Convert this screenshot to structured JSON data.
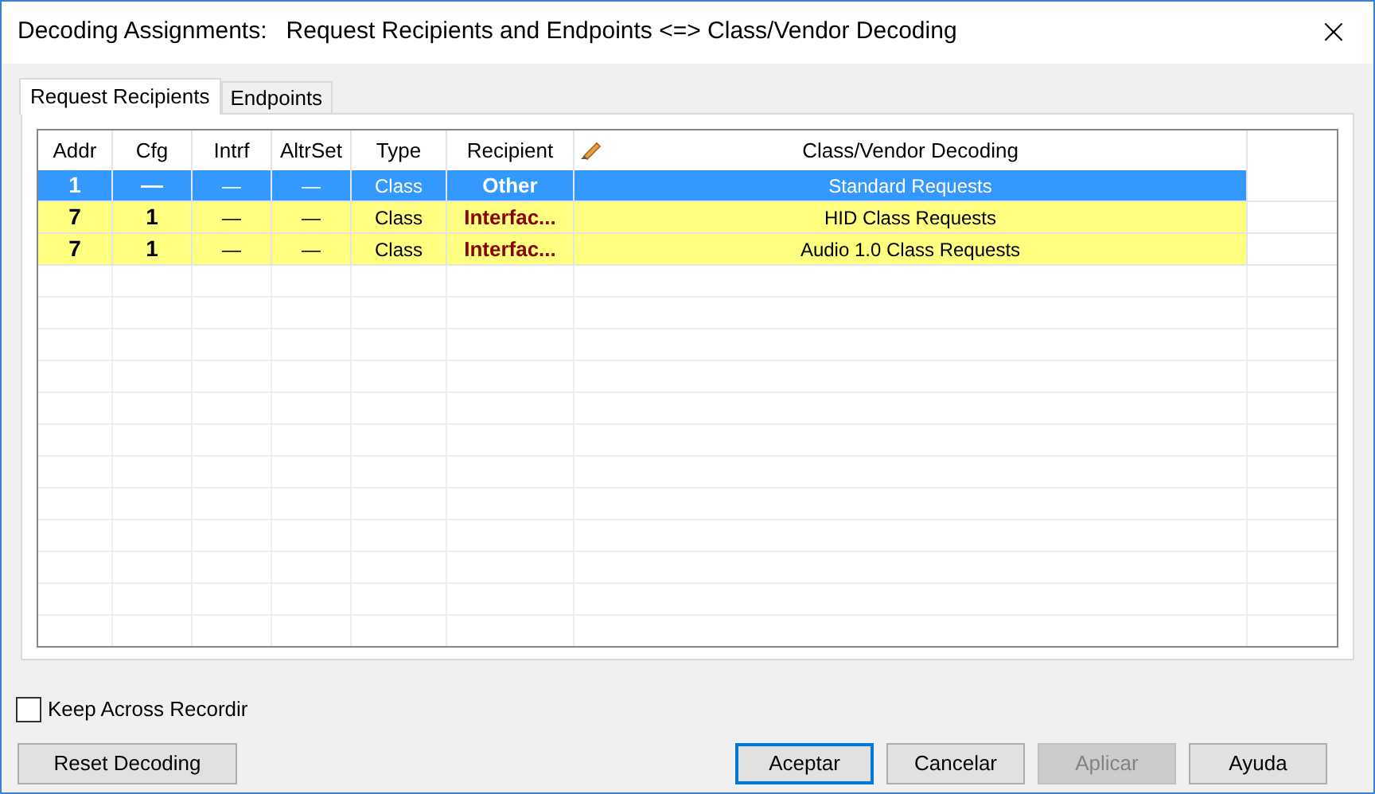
{
  "window": {
    "title": "Decoding Assignments:",
    "subtitle": "Request Recipients and Endpoints <=> Class/Vendor Decoding",
    "close": "×"
  },
  "tabs": [
    {
      "label": "Request Recipients",
      "selected": true
    },
    {
      "label": "Endpoints",
      "selected": false
    }
  ],
  "table": {
    "columns": [
      "Addr",
      "Cfg",
      "Intrf",
      "AltrSet",
      "Type",
      "Recipient",
      "Class/Vendor Decoding"
    ],
    "rows": [
      {
        "selected": true,
        "cells": [
          "1",
          "—",
          "—",
          "—",
          "Class",
          "Other",
          "Standard Requests"
        ]
      },
      {
        "selected": false,
        "cells": [
          "7",
          "1",
          "—",
          "—",
          "Class",
          "Interfac...",
          "HID Class Requests"
        ]
      },
      {
        "selected": false,
        "cells": [
          "7",
          "1",
          "—",
          "—",
          "Class",
          "Interfac...",
          "Audio 1.0 Class Requests"
        ]
      }
    ]
  },
  "keep_checkbox": {
    "label": "Keep Across Recordir",
    "checked": false
  },
  "reset_button": {
    "label": "Reset Decoding"
  },
  "buttons": [
    {
      "label": "Aceptar",
      "default": true,
      "disabled": false
    },
    {
      "label": "Cancelar",
      "default": false,
      "disabled": false
    },
    {
      "label": "Aplicar",
      "default": false,
      "disabled": true
    },
    {
      "label": "Ayuda",
      "default": false,
      "disabled": false
    }
  ]
}
